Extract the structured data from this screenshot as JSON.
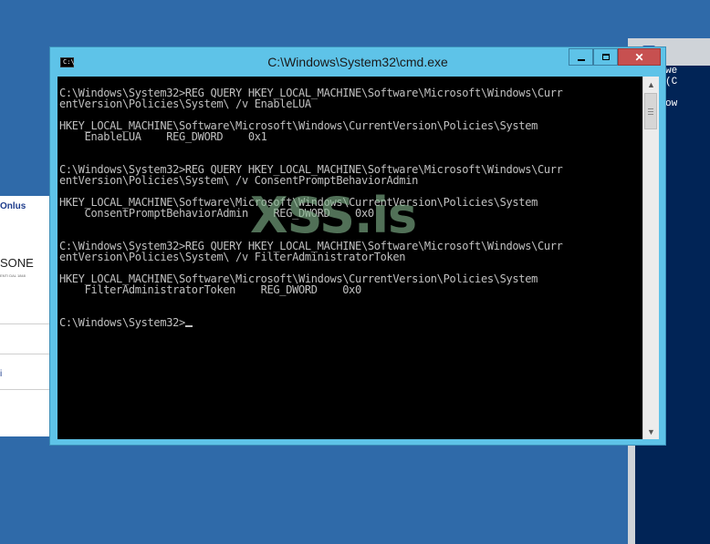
{
  "bg_left_window": {
    "text1": "Onlus",
    "text2": "SONE",
    "text3": "ENTI DAL 1848",
    "text4": "i"
  },
  "bg_right_window": {
    "lines": [
      "ws Powe",
      "ight (C",
      "",
      "\\Window"
    ]
  },
  "cmd_window": {
    "title": "C:\\Windows\\System32\\cmd.exe",
    "icon_label": "C:\\",
    "lines": [
      "C:\\Windows\\System32>REG QUERY HKEY_LOCAL_MACHINE\\Software\\Microsoft\\Windows\\Curr",
      "entVersion\\Policies\\System\\ /v EnableLUA",
      "",
      "HKEY_LOCAL_MACHINE\\Software\\Microsoft\\Windows\\CurrentVersion\\Policies\\System",
      "    EnableLUA    REG_DWORD    0x1",
      "",
      "",
      "C:\\Windows\\System32>REG QUERY HKEY_LOCAL_MACHINE\\Software\\Microsoft\\Windows\\Curr",
      "entVersion\\Policies\\System\\ /v ConsentPromptBehaviorAdmin",
      "",
      "HKEY_LOCAL_MACHINE\\Software\\Microsoft\\Windows\\CurrentVersion\\Policies\\System",
      "    ConsentPromptBehaviorAdmin    REG_DWORD    0x0",
      "",
      "",
      "C:\\Windows\\System32>REG QUERY HKEY_LOCAL_MACHINE\\Software\\Microsoft\\Windows\\Curr",
      "entVersion\\Policies\\System\\ /v FilterAdministratorToken",
      "",
      "HKEY_LOCAL_MACHINE\\Software\\Microsoft\\Windows\\CurrentVersion\\Policies\\System",
      "    FilterAdministratorToken    REG_DWORD    0x0",
      "",
      "",
      "C:\\Windows\\System32>"
    ]
  },
  "watermark": "XSS.is",
  "colors": {
    "desktop": "#2f6aa9",
    "window_frame": "#5ec3e8",
    "console_bg": "#000000",
    "console_text": "#c0c0c0",
    "close_button": "#c75050"
  }
}
